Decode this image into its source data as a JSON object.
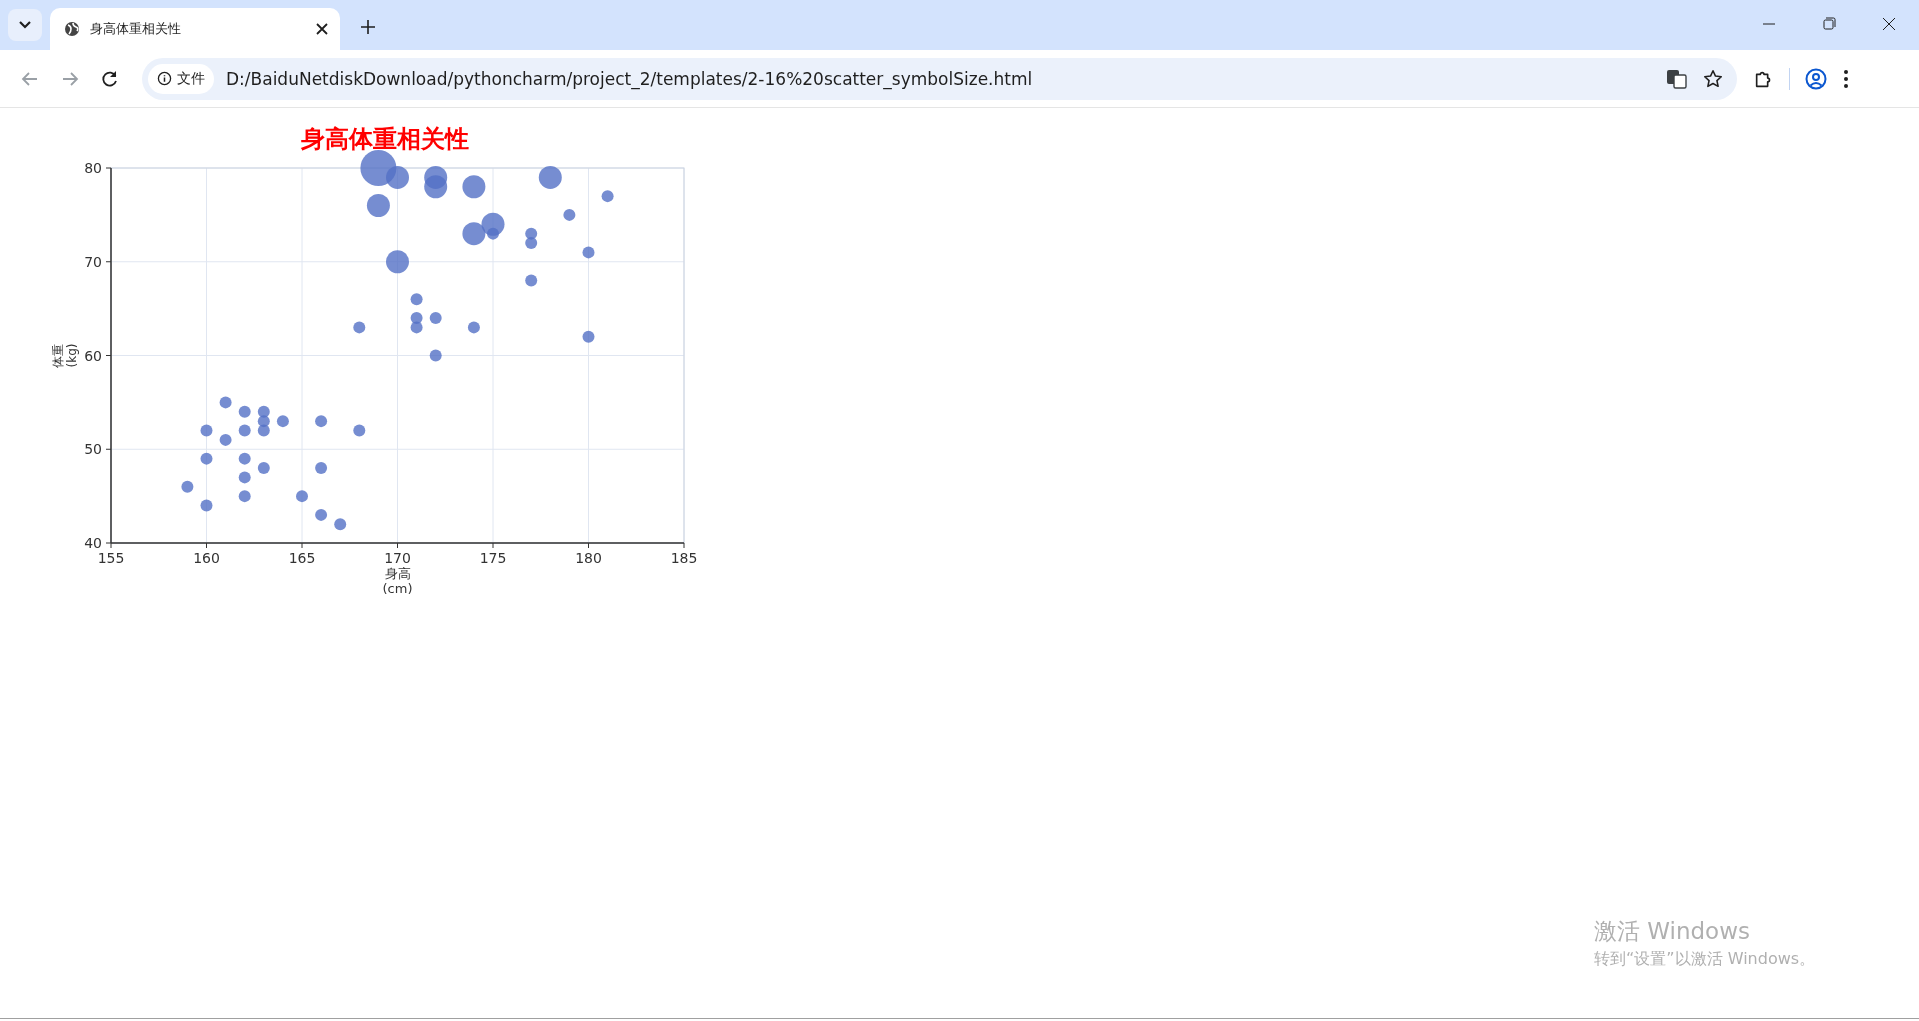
{
  "browser": {
    "tab": {
      "title": "身高体重相关性",
      "selected": true
    },
    "address": {
      "chip": "文件",
      "url": "D:/BaiduNetdiskDownload/pythoncharm/project_2/templates/2-16%20scatter_symbolSize.html"
    }
  },
  "chart": {
    "symbols": [
      {
        "kind": "xlarge"
      },
      {
        "kind": "large"
      },
      {
        "kind": "small"
      }
    ],
    "chart_data": {
      "type": "scatter",
      "grid": true,
      "title": "身高体重相关性",
      "xlabel": "身高\n(cm)",
      "ylabel": "体重\n(kg)",
      "xlim": [
        155,
        185
      ],
      "ylim": [
        40,
        80
      ],
      "xticks": [
        155,
        160,
        165,
        170,
        175,
        180,
        185
      ],
      "yticks": [
        40,
        50,
        60,
        70,
        80
      ],
      "series": [
        {
          "color": "#5470c6",
          "x": [
            169
          ],
          "values": [
            80
          ]
        },
        {
          "color": "#5470c6",
          "x": [
            170,
            172,
            172,
            174,
            178,
            169,
            174,
            175,
            170
          ],
          "values": [
            79,
            79,
            78,
            78,
            79,
            76,
            73,
            74,
            70
          ]
        },
        {
          "color": "#5470c6",
          "x": [
            175,
            177,
            177,
            179,
            181,
            180,
            177,
            171,
            171,
            171,
            172,
            168,
            174,
            172,
            180,
            161,
            162,
            163,
            163,
            164,
            166,
            160,
            162,
            163,
            168,
            161,
            160,
            162,
            163,
            166,
            162,
            159,
            162,
            165,
            160,
            166,
            167
          ],
          "values": [
            73,
            73,
            72,
            75,
            77,
            71,
            68,
            66,
            64,
            63,
            64,
            63,
            63,
            60,
            62,
            55,
            54,
            54,
            53,
            53,
            53,
            52,
            52,
            52,
            52,
            51,
            49,
            49,
            48,
            48,
            47,
            46,
            45,
            45,
            44,
            43,
            42
          ]
        }
      ]
    }
  },
  "os_notice": {
    "title": "激活 Windows",
    "text": "转到“设置”以激活 Windows。"
  }
}
